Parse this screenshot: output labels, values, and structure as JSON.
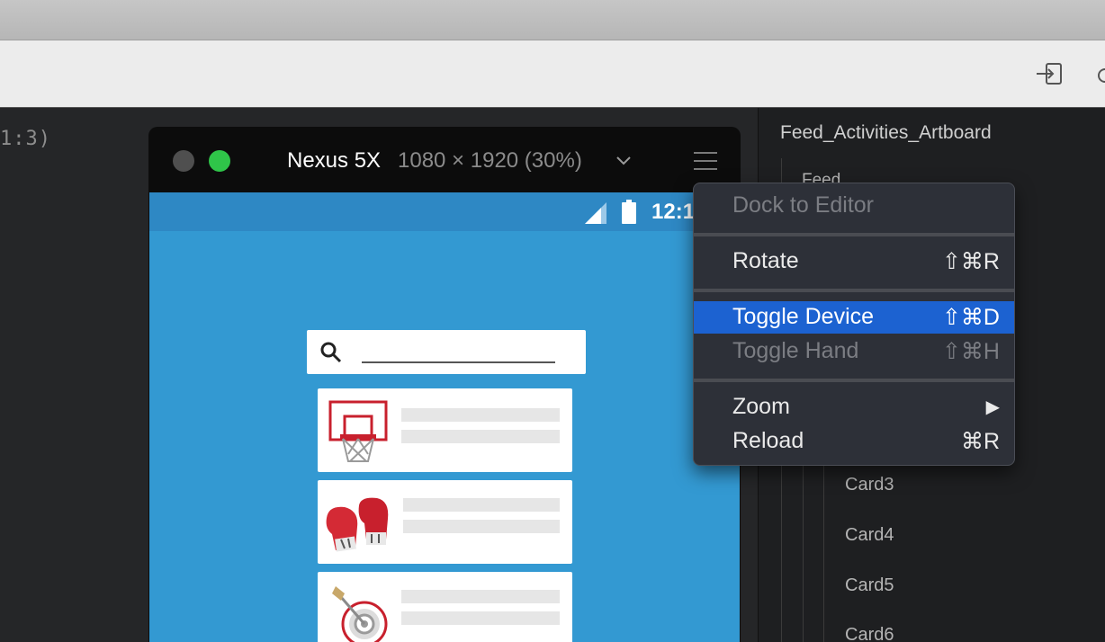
{
  "canvas": {
    "code_fragment": "1:3)"
  },
  "device": {
    "name": "Nexus 5X",
    "dimensions": "1080 × 1920 (30%)",
    "status_time": "12:1"
  },
  "layers": {
    "artboard": "Feed_Activities_Artboard",
    "feed": "Feed",
    "cards": [
      "Card3",
      "Card4",
      "Card5",
      "Card6"
    ]
  },
  "context_menu": {
    "items": [
      {
        "label": "Dock to Editor",
        "shortcut": "",
        "state": "disabled"
      },
      {
        "label": "Rotate",
        "shortcut": "⇧⌘R",
        "state": "enabled"
      },
      {
        "label": "Toggle Device",
        "shortcut": "⇧⌘D",
        "state": "highlighted"
      },
      {
        "label": "Toggle Hand",
        "shortcut": "⇧⌘H",
        "state": "disabled"
      },
      {
        "label": "Zoom",
        "shortcut": "▶",
        "state": "enabled"
      },
      {
        "label": "Reload",
        "shortcut": "⌘R",
        "state": "enabled"
      }
    ]
  },
  "colors": {
    "menu_highlight": "#1c62d1",
    "screen_blue": "#3399d2",
    "traffic_green": "#2fc549"
  },
  "icons": [
    "export-icon",
    "search-icon",
    "signal-icon",
    "battery-icon",
    "basketball-hoop-icon",
    "boxing-gloves-icon",
    "dart-target-icon",
    "hamburger-menu-icon",
    "chevron-down-icon"
  ]
}
